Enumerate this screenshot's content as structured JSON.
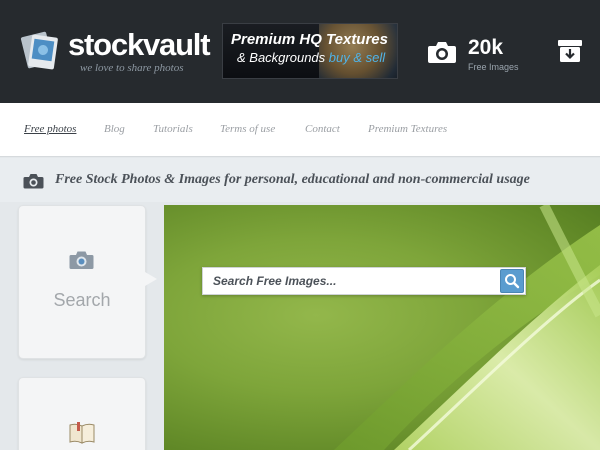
{
  "header": {
    "logo_name": "stockvault",
    "logo_tagline": "we love to share photos",
    "banner": {
      "line1": "Premium HQ Textures",
      "line2_prefix": "& Backgrounds",
      "line2_accent": "buy & sell"
    },
    "stat": {
      "value": "20k",
      "label": "Free Images"
    },
    "icons": {
      "camera": "camera-icon",
      "download": "archive-download-icon"
    }
  },
  "nav": {
    "items": [
      {
        "label": "Free photos",
        "active": true
      },
      {
        "label": "Blog"
      },
      {
        "label": "Tutorials"
      },
      {
        "label": "Terms of use"
      },
      {
        "label": "Contact"
      },
      {
        "label": "Premium Textures"
      }
    ]
  },
  "tagline": "Free Stock Photos & Images for personal, educational and non-commercial usage",
  "sidebar": {
    "search_card": {
      "label": "Search",
      "icon": "camera-icon"
    },
    "second_card": {
      "icon": "book-icon"
    }
  },
  "hero": {
    "search_placeholder": "Search Free Images...",
    "search_button_icon": "search-icon"
  },
  "colors": {
    "header_bg": "#262a2e",
    "accent_blue": "#4fb3e8",
    "hero_green": "#7ea53a",
    "search_button": "#5a9ccf"
  }
}
